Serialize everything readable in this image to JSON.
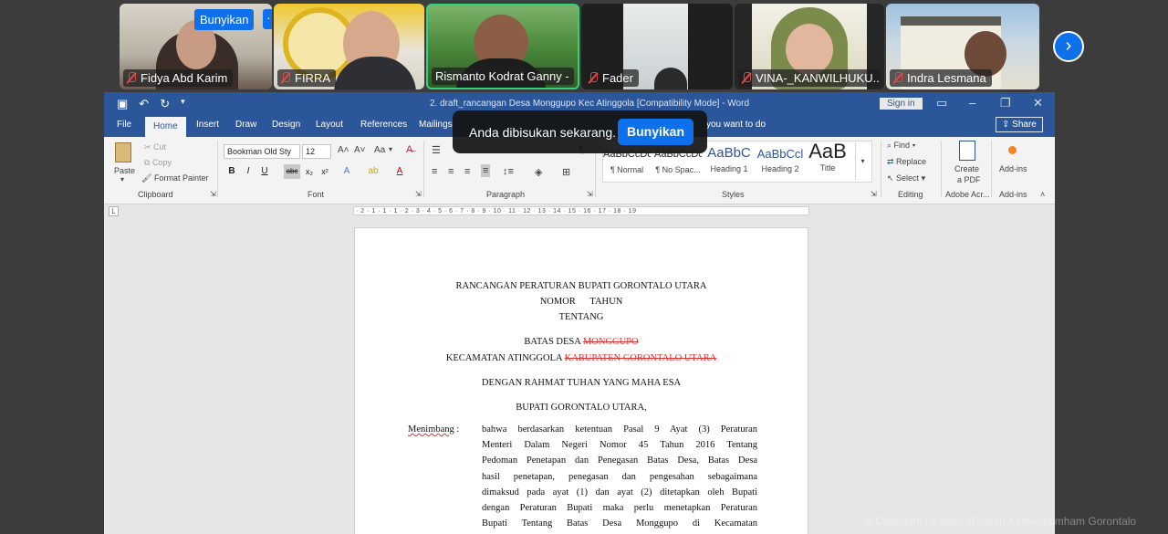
{
  "meeting": {
    "tiles": [
      {
        "name": "Fidya Abd Karim",
        "muted": true
      },
      {
        "name": "FIRRA",
        "muted": true
      },
      {
        "name": "Rismanto Kodrat Ganny -",
        "muted": false,
        "active": true
      },
      {
        "name": "Fader",
        "muted": true
      },
      {
        "name": "VINA-_KANWILHUKU...",
        "muted": true
      },
      {
        "name": "Indra Lesmana",
        "muted": true
      }
    ],
    "tile_button": "Bunyikan",
    "tile_more": "···",
    "next_icon": "chevron-right-icon",
    "toast": {
      "message": "Anda dibisukan sekarang.",
      "button": "Bunyikan"
    },
    "watermark": "© Copyright | Kantor Wilayah Kemenkumham Gorontalo"
  },
  "word": {
    "title": "2. draft_rancangan Desa Monggupo Kec Atinggola [Compatibility Mode] - Word",
    "sign_in": "Sign in",
    "share": "Share",
    "tabs": [
      "File",
      "Home",
      "Insert",
      "Draw",
      "Design",
      "Layout",
      "References",
      "Mailings"
    ],
    "tell_me": "you want to do",
    "active_tab": "Home",
    "clipboard": {
      "paste": "Paste",
      "cut": "Cut",
      "copy": "Copy",
      "format_painter": "Format Painter",
      "label": "Clipboard"
    },
    "font": {
      "name": "Bookman Old Sty",
      "size": "12",
      "case": "Aa",
      "label": "Font"
    },
    "paragraph_label": "Paragraph",
    "styles": {
      "items": [
        {
          "preview": "AaBbCcDc",
          "label": "¶ Normal"
        },
        {
          "preview": "AaBbCcDc",
          "label": "¶ No Spac..."
        },
        {
          "preview": "AaBbC",
          "label": "Heading 1"
        },
        {
          "preview": "AaBbCcl",
          "label": "Heading 2"
        },
        {
          "preview": "AaB",
          "label": "Title"
        }
      ],
      "label": "Styles"
    },
    "editing": {
      "find": "Find",
      "replace": "Replace",
      "select": "Select",
      "label": "Editing"
    },
    "adobe": {
      "create": "Create",
      "pdf": "a PDF",
      "label": "Adobe Acr..."
    },
    "addins": {
      "button": "Add-ins",
      "label": "Add-ins"
    },
    "ruler": "· 2 · 1 · 1 · 1 · 2 · 3 · 4 · 5 · 6 · 7 · 8 · 9 · 10 · 11 · 12 · 13 · 14 · 15 · 16 · 17 · 18 · 19"
  },
  "document": {
    "title1": "RANCANGAN PERATURAN BUPATI GORONTALO UTARA",
    "title2": "NOMOR      TAHUN",
    "title3": "TENTANG",
    "subject1_a": "BATAS DESA ",
    "subject1_b": "MONGGUPO",
    "subject2_a": "KECAMATAN ATINGGOLA ",
    "subject2_b": "KABUPATEN GORONTALO UTARA",
    "rahmat": "DENGAN RAHMAT TUHAN YANG MAHA ESA",
    "bupati": "BUPATI GORONTALO UTARA,",
    "menimbang_label": "Menimbang",
    "menimbang_colon": " :",
    "lines": [
      "bahwa berdasarkan ketentuan Pasal 9 Ayat (3) Peraturan",
      "Menteri Dalam Negeri Nomor 45 Tahun 2016 Tentang",
      "Pedoman Penetapan dan Penegasan Batas Desa, Batas Desa",
      "hasil penetapan, penegasan dan pengesahan sebagaimana",
      "dimaksud pada ayat (1) dan ayat (2) ditetapkan oleh Bupati",
      "dengan Peraturan Bupati maka perlu menetapkan Peraturan",
      "Bupati Tentang Batas Desa Monggupo di Kecamatan"
    ]
  }
}
